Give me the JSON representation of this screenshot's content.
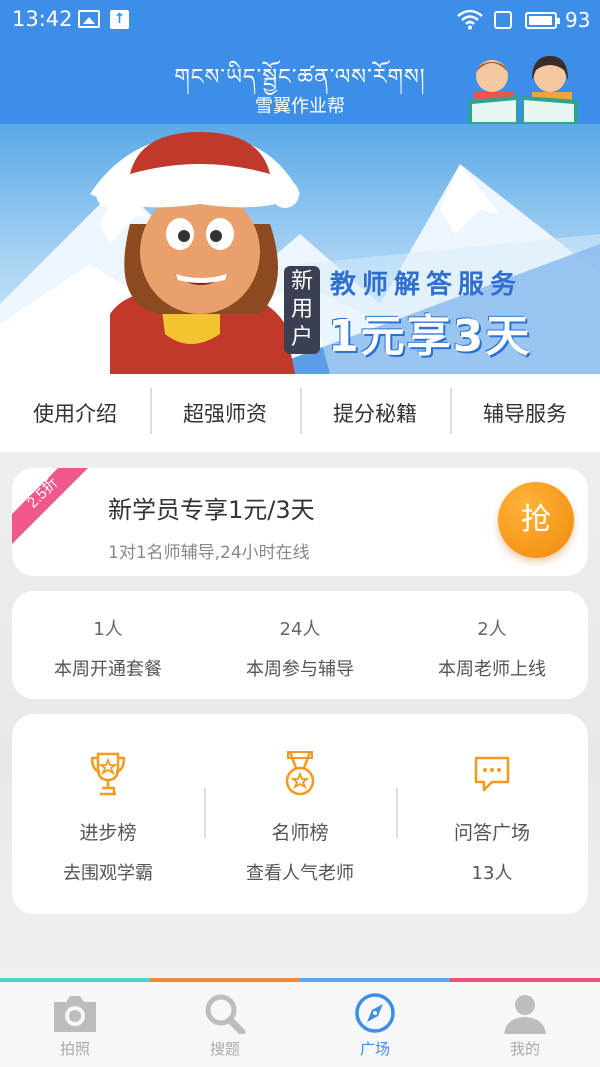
{
  "status_bar": {
    "time": "13:42",
    "battery": "93"
  },
  "header": {
    "tibetan_title": "གངས་ཡིད་སྦྱོང་ཚན་ལས་རོགས།",
    "app_name": "雪翼作业帮"
  },
  "banner": {
    "tag": "新用户",
    "headline": "教师解答服务",
    "promo": "1元享3天"
  },
  "menu": {
    "items": [
      {
        "label": "使用介绍"
      },
      {
        "label": "超强师资"
      },
      {
        "label": "提分秘籍"
      },
      {
        "label": "辅导服务"
      }
    ]
  },
  "offer": {
    "ribbon": "2.5折",
    "title": "新学员专享1元/3天",
    "subtitle": "1对1名师辅导,24小时在线",
    "button": "抢"
  },
  "stats": [
    {
      "value": "1人",
      "label": "本周开通套餐"
    },
    {
      "value": "24人",
      "label": "本周参与辅导"
    },
    {
      "value": "2人",
      "label": "本周老师上线"
    }
  ],
  "features": [
    {
      "icon": "trophy-icon",
      "name": "进步榜",
      "desc": "去围观学霸"
    },
    {
      "icon": "medal-icon",
      "name": "名师榜",
      "desc": "查看人气老师"
    },
    {
      "icon": "chat-icon",
      "name": "问答广场",
      "desc": "13人"
    }
  ],
  "nav": {
    "tabs": [
      {
        "icon": "camera-icon",
        "label": "拍照",
        "active": false
      },
      {
        "icon": "search-icon",
        "label": "搜题",
        "active": false
      },
      {
        "icon": "compass-icon",
        "label": "广场",
        "active": true
      },
      {
        "icon": "person-icon",
        "label": "我的",
        "active": false
      }
    ],
    "stripe_colors": [
      "#4fd3c4",
      "#f08a3a",
      "#58a8f0",
      "#f04f7a"
    ]
  },
  "colors": {
    "primary": "#3d8ee9",
    "accent": "#f39a1e",
    "ribbon": "#f0578a"
  }
}
